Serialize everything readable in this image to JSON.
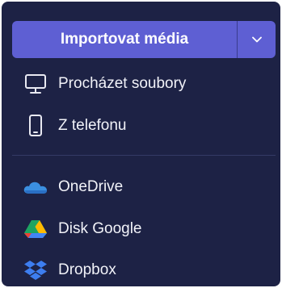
{
  "import_button": {
    "label": "Importovat média"
  },
  "menu": {
    "local_items": [
      {
        "label": "Procházet soubory",
        "icon": "monitor-icon"
      },
      {
        "label": "Z telefonu",
        "icon": "phone-icon"
      }
    ],
    "cloud_items": [
      {
        "label": "OneDrive",
        "icon": "onedrive-icon"
      },
      {
        "label": "Disk Google",
        "icon": "google-drive-icon"
      },
      {
        "label": "Dropbox",
        "icon": "dropbox-icon"
      }
    ]
  },
  "colors": {
    "panel_background": "#1d2245",
    "accent": "#5e5fd3",
    "onedrive": "#3b8fe0",
    "dropbox": "#3d7ef0"
  }
}
